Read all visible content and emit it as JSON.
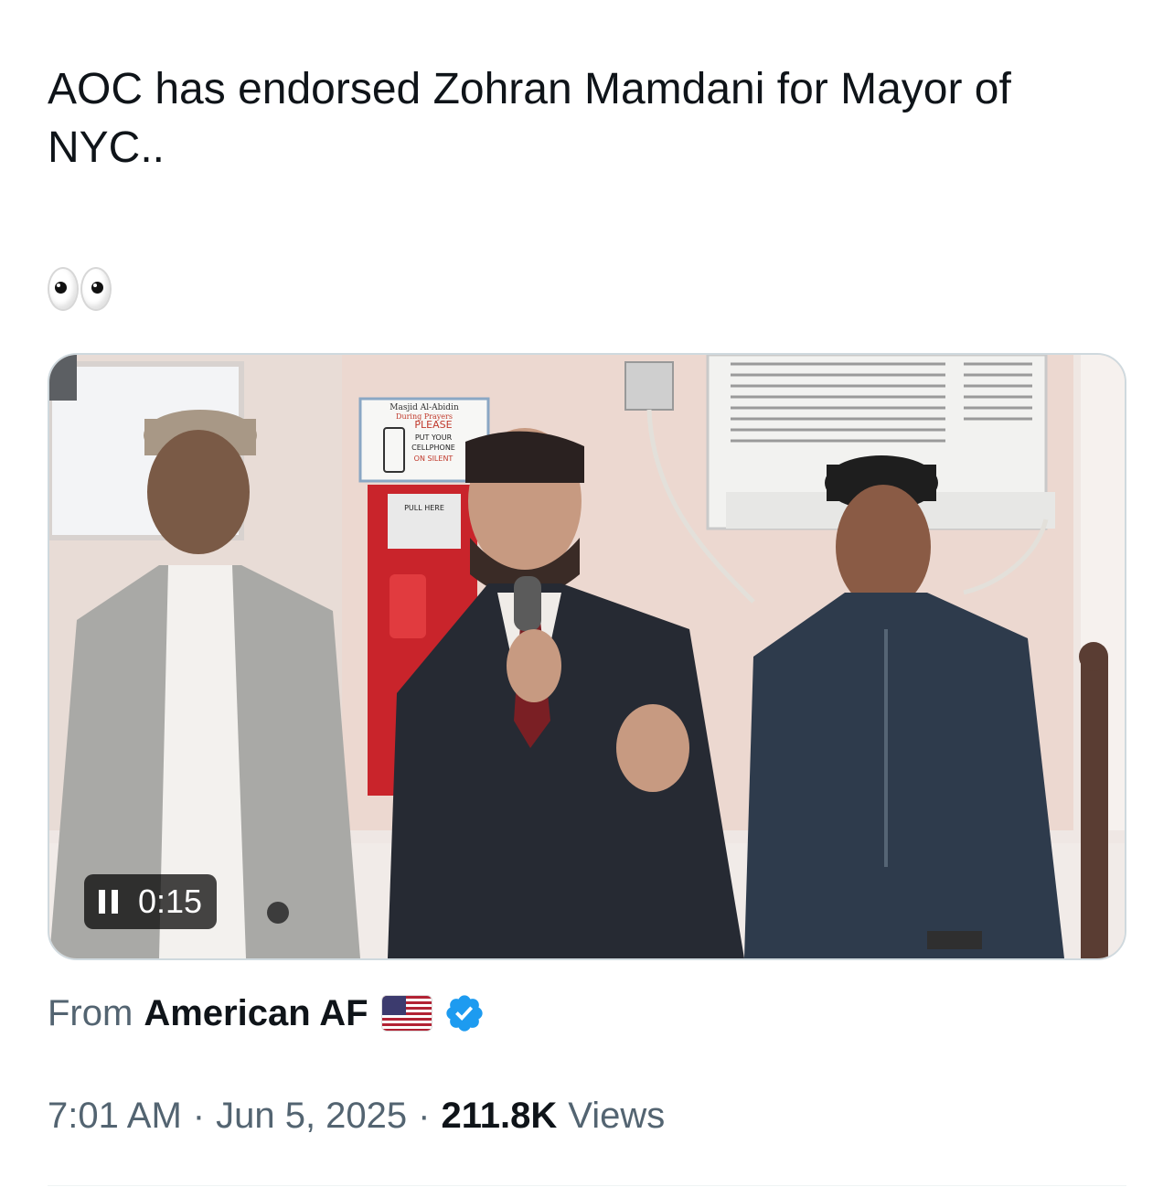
{
  "tweet": {
    "text_line1": "AOC has endorsed Zohran Mamdani for Mayor of",
    "text_line2": "NYC..",
    "emoji": "eyes"
  },
  "video": {
    "elapsed": "0:15",
    "state": "playing",
    "sign": {
      "line1": "Masjid Al-Abidin",
      "line2": "During Prayers",
      "line3": "PLEASE",
      "line4": "PUT YOUR",
      "line5": "CELLPHONE",
      "line6": "ON SILENT",
      "pull": "PULL HERE"
    }
  },
  "source": {
    "prefix": "From",
    "author": "American AF",
    "flag": "us-flag-icon",
    "verified": true,
    "verified_color": "#1d9bf0"
  },
  "meta": {
    "time": "7:01 AM",
    "date": "Jun 5, 2025",
    "views_count": "211.8K",
    "views_label": "Views"
  },
  "colors": {
    "text": "#0f1419",
    "secondary": "#536471",
    "border": "#cfd9de"
  }
}
